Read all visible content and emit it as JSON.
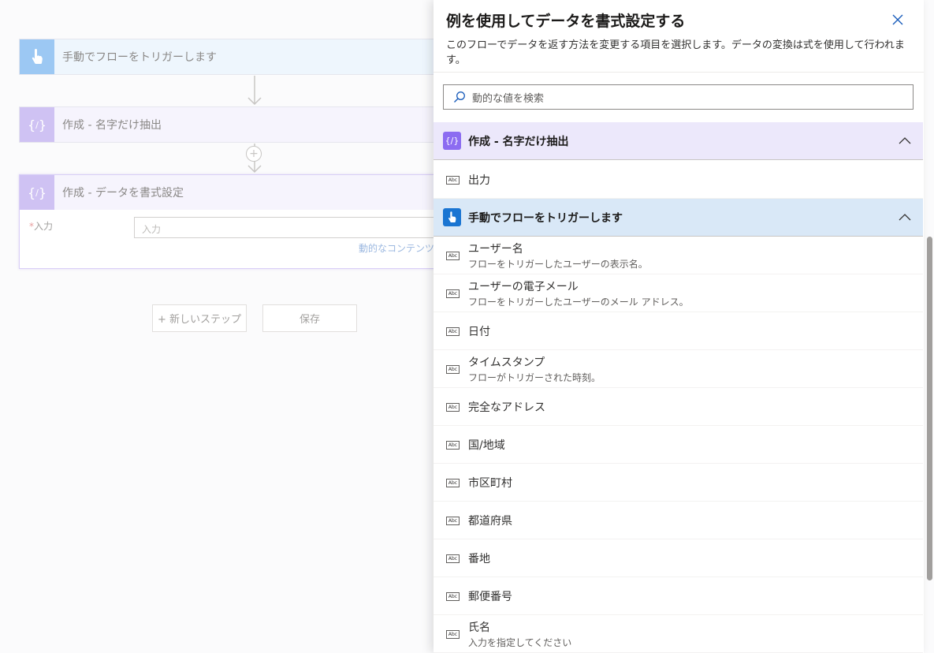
{
  "canvas": {
    "trigger_title": "手動でフローをトリガーします",
    "compose1_title": "作成 - 名字だけ抽出",
    "compose2_title": "作成 - データを書式設定",
    "input_label": "入力",
    "input_placeholder": "入力",
    "dynamic_link": "動的なコンテンツ",
    "new_step_label": "+ 新しいステップ",
    "save_label": "保存"
  },
  "panel": {
    "title": "例を使用してデータを書式設定する",
    "description": "このフローでデータを返す方法を変更する項目を選択します。データの変換は式を使用して行われます。",
    "search_placeholder": "動的な値を検索",
    "compose_section": {
      "title": "作成 - 名字だけ抽出",
      "items": [
        {
          "label": "出力"
        }
      ]
    },
    "trigger_section": {
      "title": "手動でフローをトリガーします",
      "items": [
        {
          "label": "ユーザー名",
          "desc": "フローをトリガーしたユーザーの表示名。"
        },
        {
          "label": "ユーザーの電子メール",
          "desc": "フローをトリガーしたユーザーのメール アドレス。"
        },
        {
          "label": "日付"
        },
        {
          "label": "タイムスタンプ",
          "desc": "フローがトリガーされた時刻。"
        },
        {
          "label": "完全なアドレス"
        },
        {
          "label": "国/地域"
        },
        {
          "label": "市区町村"
        },
        {
          "label": "都道府県"
        },
        {
          "label": "番地"
        },
        {
          "label": "郵便番号"
        },
        {
          "label": "氏名",
          "desc": "入力を指定してください"
        }
      ]
    },
    "icon_text": "Abc"
  }
}
